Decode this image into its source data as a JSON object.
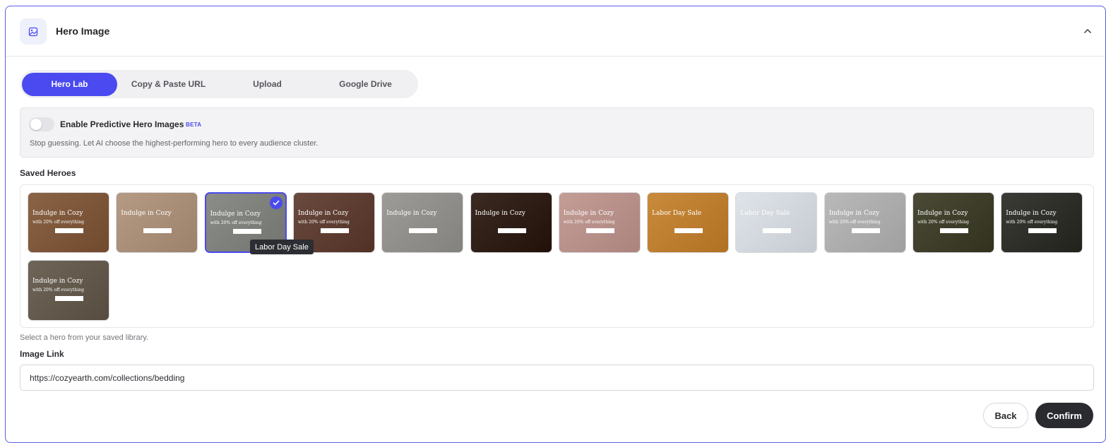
{
  "header": {
    "title": "Hero Image",
    "icon": "image-icon"
  },
  "tabs": [
    {
      "label": "Hero Lab",
      "active": true
    },
    {
      "label": "Copy & Paste URL",
      "active": false
    },
    {
      "label": "Upload",
      "active": false
    },
    {
      "label": "Google Drive",
      "active": false
    }
  ],
  "predictive": {
    "label": "Enable Predictive Hero Images",
    "badge": "BETA",
    "description": "Stop guessing. Let AI choose the highest-performing hero to every audience cluster.",
    "enabled": false
  },
  "saved_heroes": {
    "label": "Saved Heroes",
    "helper": "Select a hero from your saved library.",
    "tooltip": "Labor Day Sale",
    "items": [
      {
        "headline": "Indulge in Cozy",
        "subline": "with 20% off everything",
        "bg": "#8a6346"
      },
      {
        "headline": "Indulge in Cozy",
        "subline": "",
        "bg": "#b59a84"
      },
      {
        "headline": "Indulge in Cozy",
        "subline": "with 20% off everything",
        "bg": "#8b8d88",
        "selected": true
      },
      {
        "headline": "Indulge in Cozy",
        "subline": "with 20% off everything",
        "bg": "#6a4a3e"
      },
      {
        "headline": "Indulge in Cozy",
        "subline": "",
        "bg": "#9d9b97"
      },
      {
        "headline": "Indulge in Cozy",
        "subline": "",
        "bg": "#3b2a22"
      },
      {
        "headline": "Indulge in Cozy",
        "subline": "with 20% off everything",
        "bg": "#c49d96"
      },
      {
        "headline": "Labor Day Sale",
        "subline": "",
        "bg": "#c98a3c"
      },
      {
        "headline": "Labor Day Sale",
        "subline": "",
        "bg": "#dfe4ea"
      },
      {
        "headline": "Indulge in Cozy",
        "subline": "with 20% off everything",
        "bg": "#b9b9b9"
      },
      {
        "headline": "Indulge in Cozy",
        "subline": "with 20% off everything",
        "bg": "#4a4a36"
      },
      {
        "headline": "Indulge in Cozy",
        "subline": "with 20% off everything",
        "bg": "#3b3b36"
      },
      {
        "headline": "Indulge in Cozy",
        "subline": "with 20% off everything",
        "bg": "#6f6558"
      }
    ]
  },
  "image_link": {
    "label": "Image Link",
    "value": "https://cozyearth.com/collections/bedding"
  },
  "actions": {
    "back": "Back",
    "confirm": "Confirm"
  },
  "colors": {
    "accent": "#4a4af0",
    "border": "#5b5fe0",
    "dark": "#2a2b2f"
  }
}
